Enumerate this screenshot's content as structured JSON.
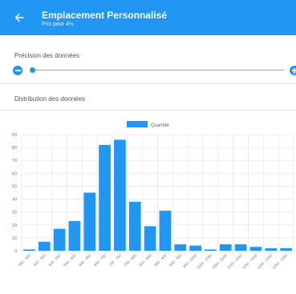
{
  "header": {
    "title": "Emplacement Personnalisé",
    "subtitle": "Prix pour 4½"
  },
  "precision": {
    "label": "Précision des données",
    "slider_value": 0
  },
  "distribution": {
    "label": "Distribution des données"
  },
  "colors": {
    "accent": "#2196f3",
    "bar": "#2196f3",
    "grid": "#e8e8e8"
  },
  "chart_data": {
    "type": "bar",
    "legend_position": "top-center",
    "grid": true,
    "ylim": [
      0,
      90
    ],
    "yticks": [
      0,
      10,
      20,
      30,
      40,
      50,
      60,
      70,
      80,
      90
    ],
    "categories": [
      "350 - 400",
      "400 - 500",
      "500 - 550",
      "550 - 600",
      "600 - 650",
      "650 - 700",
      "700 - 750",
      "750 - 800",
      "800 - 850",
      "850 - 900",
      "900 - 950",
      "950 - 1000",
      "1000 - 1050",
      "1050 - 1100",
      "1100 - 1150",
      "1150 - 1200",
      "1200 - 1250",
      "1250 - 1300"
    ],
    "series": [
      {
        "name": "Quantité",
        "values": [
          1,
          7,
          17,
          23,
          45,
          82,
          86,
          38,
          19,
          31,
          5,
          4,
          1,
          5,
          5,
          3,
          2,
          2
        ]
      }
    ]
  }
}
